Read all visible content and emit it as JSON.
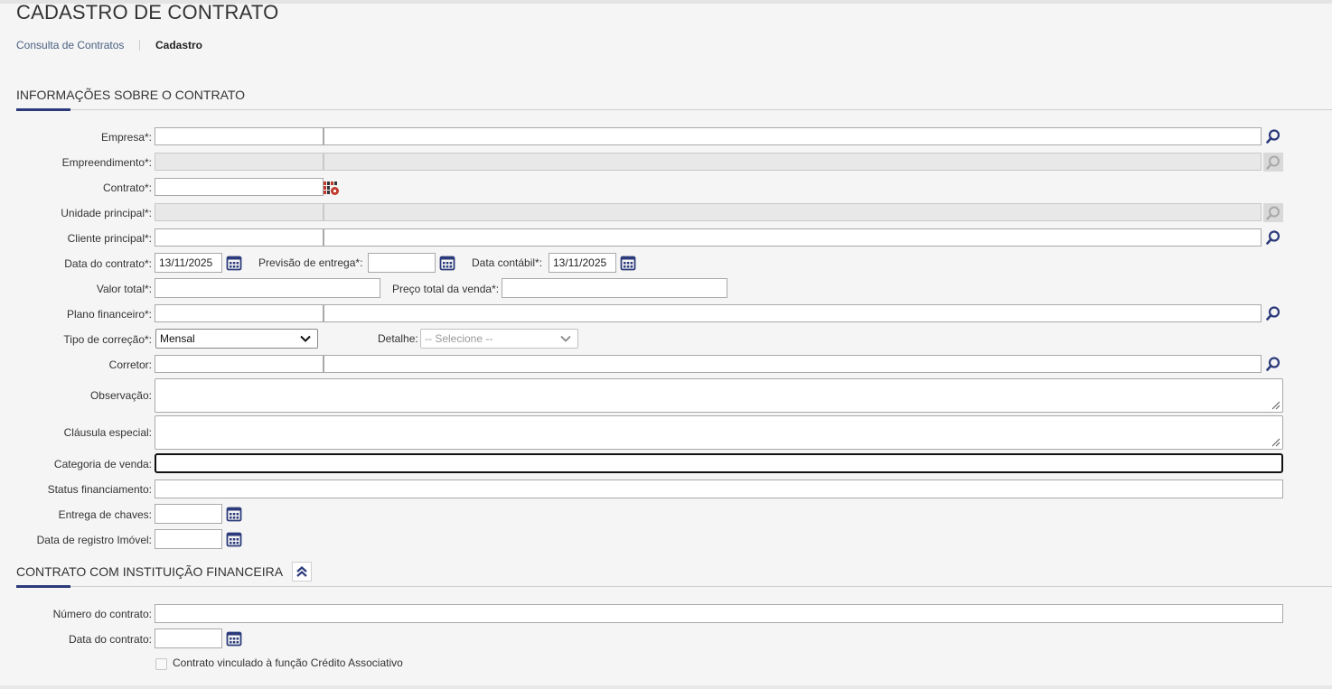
{
  "page": {
    "title": "CADASTRO DE CONTRATO"
  },
  "breadcrumb": {
    "link": "Consulta de Contratos",
    "current": "Cadastro"
  },
  "section1": {
    "title": "INFORMAÇÕES SOBRE O CONTRATO",
    "fields": {
      "empresa": "Empresa*:",
      "empreendimento": "Empreendimento*:",
      "contrato": "Contrato*:",
      "unidade": "Unidade principal*:",
      "cliente": "Cliente principal*:",
      "data_contrato": "Data do contrato*:",
      "data_contrato_value": "13/11/2025",
      "previsao": "Previsão de entrega*:",
      "data_contabil": "Data contábil*:",
      "data_contabil_value": "13/11/2025",
      "valor_total": "Valor total*:",
      "preco_total": "Preço total da venda*:",
      "plano": "Plano financeiro*:",
      "tipo_correcao": "Tipo de correção*:",
      "tipo_correcao_value": "Mensal",
      "detalhe": "Detalhe:",
      "detalhe_value": "-- Selecione --",
      "corretor": "Corretor:",
      "observacao": "Observação:",
      "clausula": "Cláusula especial:",
      "categoria": "Categoria de venda:",
      "status_fin": "Status financiamento:",
      "entrega_chaves": "Entrega de chaves:",
      "data_registro": "Data de registro Imóvel:"
    }
  },
  "section2": {
    "title": "CONTRATO COM INSTITUIÇÃO FINANCEIRA",
    "fields": {
      "numero": "Número do contrato:",
      "data": "Data do contrato:",
      "checkbox_label": "Contrato vinculado à função Crédito Associativo"
    }
  },
  "colors": {
    "accent": "#2b3a7a",
    "icon": "#2b3a7a",
    "disabled": "#e8e8e8"
  },
  "icons": {
    "search": "search-icon",
    "calendar": "calendar-icon",
    "generate": "code-generator-icon",
    "collapse": "chevron-up-double-icon"
  }
}
